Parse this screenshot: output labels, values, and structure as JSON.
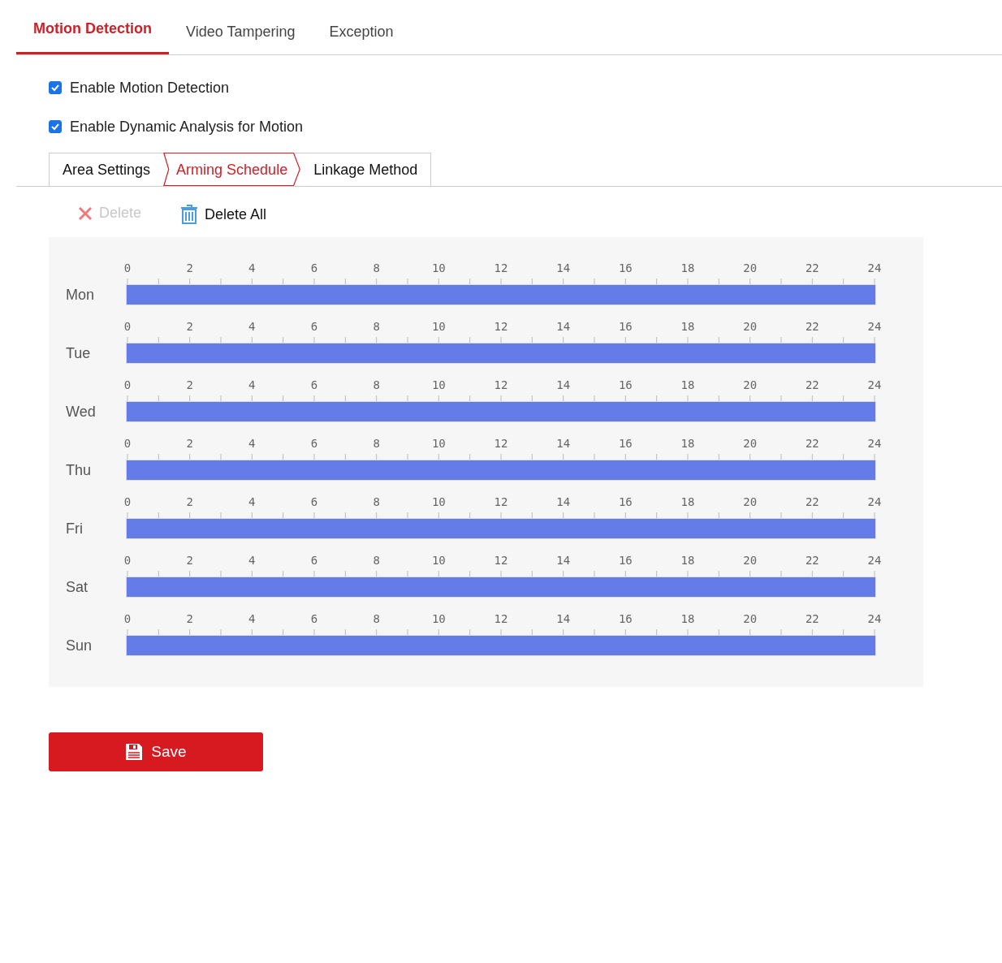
{
  "tabs": [
    {
      "label": "Motion Detection",
      "selected": true
    },
    {
      "label": "Video Tampering",
      "selected": false
    },
    {
      "label": "Exception",
      "selected": false
    }
  ],
  "options": [
    {
      "label": "Enable Motion Detection",
      "checked": true
    },
    {
      "label": "Enable Dynamic Analysis for Motion",
      "checked": true
    }
  ],
  "steps": [
    {
      "label": "Area Settings",
      "selected": false
    },
    {
      "label": "Arming Schedule",
      "selected": true
    },
    {
      "label": "Linkage Method",
      "selected": false
    }
  ],
  "toolbar": [
    {
      "label": "Delete",
      "kind": "delete",
      "disabled": true
    },
    {
      "label": "Delete All",
      "kind": "delete_all",
      "disabled": false
    }
  ],
  "schedule": [
    {
      "day": "Mon",
      "level": 1,
      "ticks": [
        "0",
        "2",
        "4",
        "6",
        "8",
        "10",
        "12",
        "14",
        "16",
        "18",
        "20",
        "22",
        "24"
      ]
    },
    {
      "day": "Tue",
      "level": 1,
      "ticks": [
        "0",
        "2",
        "4",
        "6",
        "8",
        "10",
        "12",
        "14",
        "16",
        "18",
        "20",
        "22",
        "24"
      ]
    },
    {
      "day": "Wed",
      "level": 1,
      "ticks": [
        "0",
        "2",
        "4",
        "6",
        "8",
        "10",
        "12",
        "14",
        "16",
        "18",
        "20",
        "22",
        "24"
      ]
    },
    {
      "day": "Thu",
      "level": 1,
      "ticks": [
        "0",
        "2",
        "4",
        "6",
        "8",
        "10",
        "12",
        "14",
        "16",
        "18",
        "20",
        "22",
        "24"
      ]
    },
    {
      "day": "Fri",
      "level": 1,
      "ticks": [
        "0",
        "2",
        "4",
        "6",
        "8",
        "10",
        "12",
        "14",
        "16",
        "18",
        "20",
        "22",
        "24"
      ]
    },
    {
      "day": "Sat",
      "level": 1,
      "ticks": [
        "0",
        "2",
        "4",
        "6",
        "8",
        "10",
        "12",
        "14",
        "16",
        "18",
        "20",
        "22",
        "24"
      ]
    },
    {
      "day": "Sun",
      "level": 1,
      "ticks": [
        "0",
        "2",
        "4",
        "6",
        "8",
        "10",
        "12",
        "14",
        "16",
        "18",
        "20",
        "22",
        "24"
      ]
    }
  ],
  "save_button": {
    "label": "Save"
  }
}
